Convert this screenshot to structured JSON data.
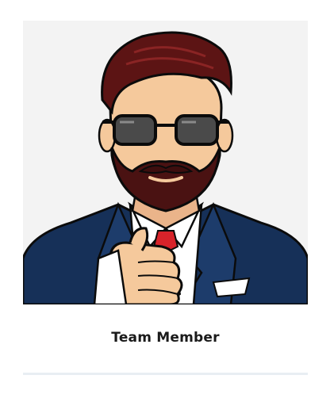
{
  "team_card": {
    "member_name": "Team Member",
    "photo_subject": "avatar-illustration-bearded-man-in-suit-pointing",
    "colors": {
      "photo_background": "#f3f3f3",
      "suit": "#163058",
      "tie": "#d8232a",
      "hair": "#5c1414",
      "skin": "#f5c99c",
      "divider": "#e8eef3"
    }
  }
}
